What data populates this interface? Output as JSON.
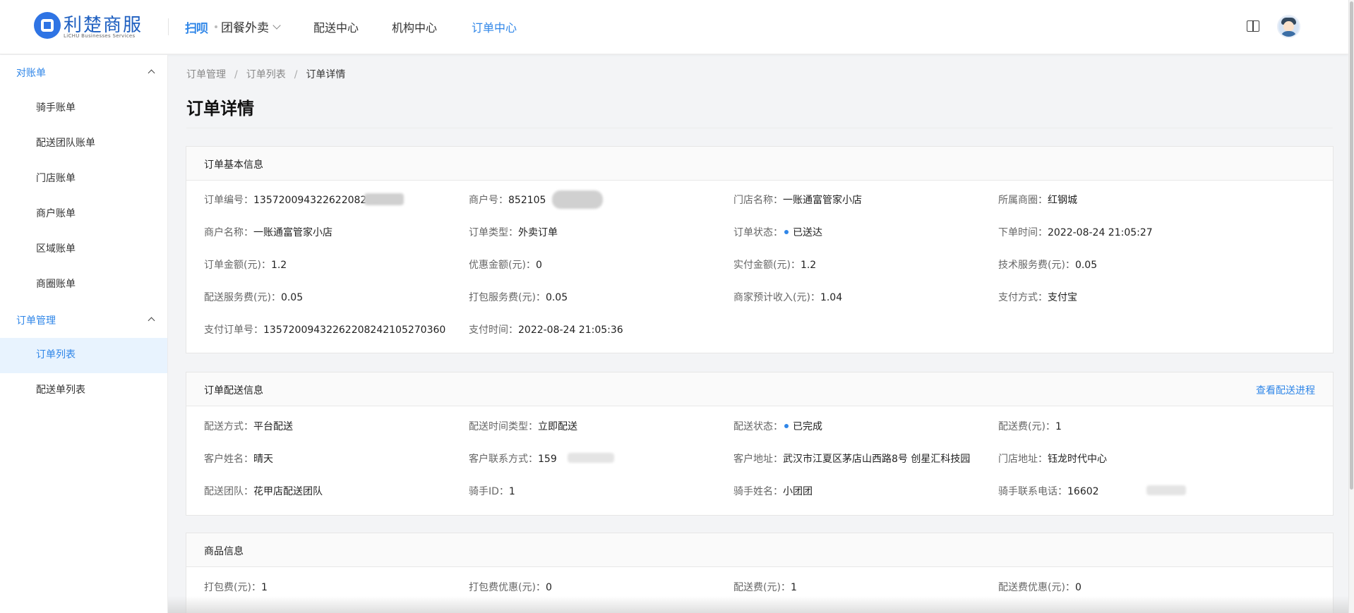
{
  "header": {
    "logo_text": "利楚商服",
    "logo_sub": "LiCHU Businesses Services",
    "brand_mark": "扫呗",
    "brand_name": "团餐外卖",
    "nav": [
      "配送中心",
      "机构中心",
      "订单中心"
    ],
    "active_nav": "订单中心"
  },
  "sidebar": {
    "groups": [
      {
        "label": "对账单",
        "items": [
          "骑手账单",
          "配送团队账单",
          "门店账单",
          "商户账单",
          "区域账单",
          "商圈账单"
        ]
      },
      {
        "label": "订单管理",
        "items": [
          "订单列表",
          "配送单列表"
        ]
      }
    ],
    "active_item": "订单列表"
  },
  "breadcrumb": [
    "订单管理",
    "订单列表",
    "订单详情"
  ],
  "page_title": "订单详情",
  "basic_info": {
    "title": "订单基本信息",
    "fields": [
      {
        "label": "订单编号：",
        "value": "13572009432262208242"
      },
      {
        "label": "商户号：",
        "value": "852105"
      },
      {
        "label": "门店名称：",
        "value": "一账通富管家小店"
      },
      {
        "label": "所属商圈：",
        "value": "红钢城"
      },
      {
        "label": "商户名称：",
        "value": "一账通富管家小店"
      },
      {
        "label": "订单类型：",
        "value": "外卖订单"
      },
      {
        "label": "订单状态：",
        "value": "已送达"
      },
      {
        "label": "下单时间：",
        "value": "2022-08-24 21:05:27"
      },
      {
        "label": "订单金额(元)：",
        "value": "1.2"
      },
      {
        "label": "优惠金额(元)：",
        "value": "0"
      },
      {
        "label": "实付金额(元)：",
        "value": "1.2"
      },
      {
        "label": "技术服务费(元)：",
        "value": "0.05"
      },
      {
        "label": "配送服务费(元)：",
        "value": "0.05"
      },
      {
        "label": "打包服务费(元)：",
        "value": "0.05"
      },
      {
        "label": "商家预计收入(元)：",
        "value": "1.04"
      },
      {
        "label": "支付方式：",
        "value": "支付宝"
      },
      {
        "label": "支付订单号：",
        "value": "13572009432262208242105270360"
      },
      {
        "label": "支付时间：",
        "value": "2022-08-24 21:05:36"
      }
    ]
  },
  "delivery_info": {
    "title": "订单配送信息",
    "link": "查看配送进程",
    "fields": [
      {
        "label": "配送方式：",
        "value": "平台配送"
      },
      {
        "label": "配送时间类型：",
        "value": "立即配送"
      },
      {
        "label": "配送状态：",
        "value": "已完成"
      },
      {
        "label": "配送费(元)：",
        "value": "1"
      },
      {
        "label": "客户姓名：",
        "value": "晴天"
      },
      {
        "label": "客户联系方式：",
        "value": "159"
      },
      {
        "label": "客户地址：",
        "value": "武汉市江夏区茅店山西路8号 创星汇科技园"
      },
      {
        "label": "门店地址：",
        "value": "钰龙时代中心"
      },
      {
        "label": "配送团队：",
        "value": "花甲店配送团队"
      },
      {
        "label": "骑手ID：",
        "value": "1"
      },
      {
        "label": "骑手姓名：",
        "value": "小团团"
      },
      {
        "label": "骑手联系电话：",
        "value": "16602"
      }
    ]
  },
  "goods_info": {
    "title": "商品信息",
    "fields": [
      {
        "label": "打包费(元)：",
        "value": "1"
      },
      {
        "label": "打包费优惠(元)：",
        "value": "0"
      },
      {
        "label": "配送费(元)：",
        "value": "1"
      },
      {
        "label": "配送费优惠(元)：",
        "value": "0"
      }
    ]
  },
  "colors": {
    "accent": "#2f86e8",
    "selected_bg": "#e8f3fe"
  }
}
